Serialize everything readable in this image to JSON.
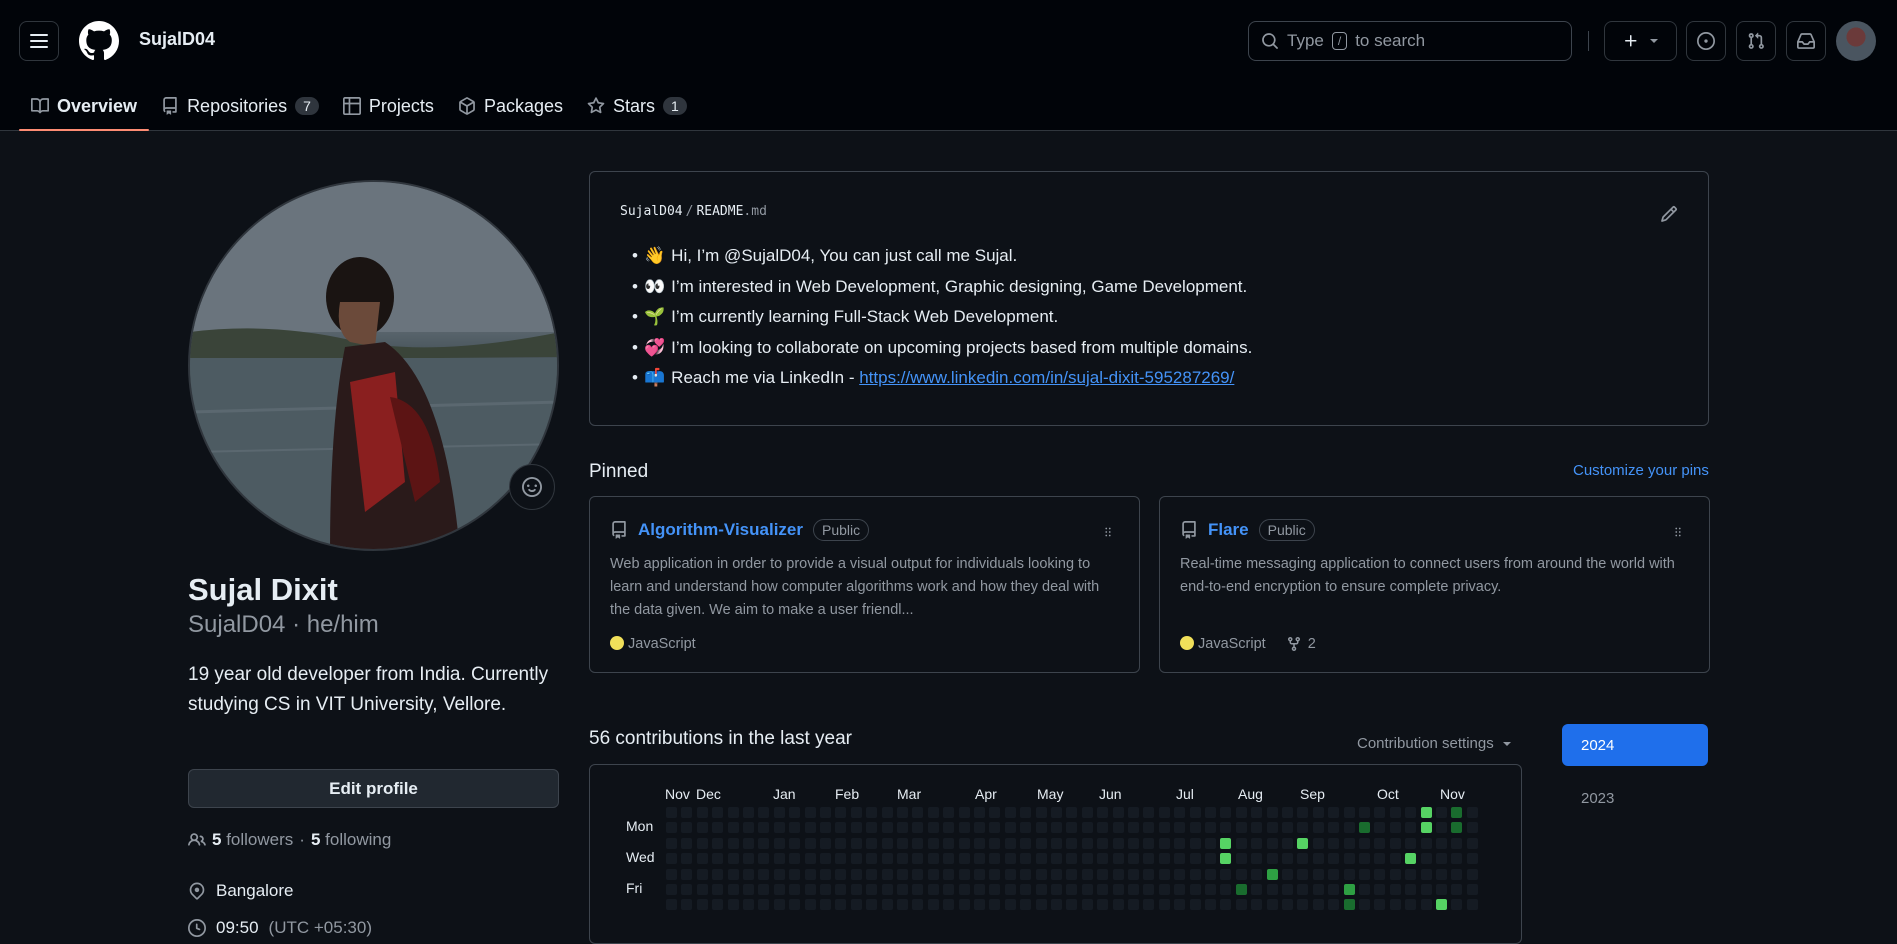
{
  "header": {
    "username": "SujalD04",
    "search": {
      "prefix": "Type",
      "key": "/",
      "suffix": "to search"
    }
  },
  "tabs": [
    {
      "label": "Overview",
      "count": null,
      "active": true,
      "icon": "book-icon"
    },
    {
      "label": "Repositories",
      "count": "7",
      "icon": "repo-icon"
    },
    {
      "label": "Projects",
      "count": null,
      "icon": "table-icon"
    },
    {
      "label": "Packages",
      "count": null,
      "icon": "package-icon"
    },
    {
      "label": "Stars",
      "count": "1",
      "icon": "star-icon"
    }
  ],
  "profile": {
    "full_name": "Sujal Dixit",
    "handle": "SujalD04 · he/him",
    "bio": "19 year old developer from India. Currently studying CS in VIT University, Vellore.",
    "edit_label": "Edit profile",
    "followers_count": "5",
    "followers_label": "followers",
    "sep": "·",
    "following_count": "5",
    "following_label": "following",
    "location": "Bangalore",
    "time": "09:50",
    "timezone": "(UTC +05:30)"
  },
  "readme": {
    "owner": "SujalD04",
    "file": "README",
    "ext": ".md",
    "items": [
      {
        "emoji": "👋",
        "text": "Hi, I’m @SujalD04, You can just call me Sujal."
      },
      {
        "emoji": "👀",
        "text": "I’m interested in Web Development, Graphic designing, Game Development."
      },
      {
        "emoji": "🌱",
        "text": "I’m currently learning Full-Stack Web Development."
      },
      {
        "emoji": "💞️",
        "text": "I’m looking to collaborate on upcoming projects based from multiple domains."
      },
      {
        "emoji": "📫",
        "text": "Reach me via LinkedIn - ",
        "link": "https://www.linkedin.com/in/sujal-dixit-595287269/"
      }
    ]
  },
  "pinned": {
    "title": "Pinned",
    "customize": "Customize your pins",
    "cards": [
      {
        "name": "Algorithm-Visualizer",
        "visibility": "Public",
        "description": "Web application in order to provide a visual output for individuals looking to learn and understand how computer algorithms work and how they deal with the data given. We aim to make a user friendl...",
        "language": "JavaScript",
        "language_color": "#f1e05a",
        "forks": null
      },
      {
        "name": "Flare",
        "visibility": "Public",
        "description": "Real-time messaging application to connect users from around the world with end-to-end encryption to ensure complete privacy.",
        "language": "JavaScript",
        "language_color": "#f1e05a",
        "forks": "2"
      }
    ]
  },
  "contributions": {
    "title": "56 contributions in the last year",
    "settings": "Contribution settings",
    "months": [
      "Nov",
      "Dec",
      "Jan",
      "Feb",
      "Mar",
      "Apr",
      "May",
      "Jun",
      "Jul",
      "Aug",
      "Sep",
      "Oct",
      "Nov"
    ],
    "days": [
      "Mon",
      "Wed",
      "Fri"
    ],
    "years": [
      "2024",
      "2023"
    ],
    "colors": {
      "empty": "#151b23",
      "l1": "#033a16",
      "l2": "#196c2e",
      "l3": "#2ea043",
      "l4": "#56d364"
    },
    "active_cells": [
      {
        "week": 51,
        "day": 0,
        "level": "l2"
      },
      {
        "week": 49,
        "day": 0,
        "level": "l4"
      },
      {
        "week": 49,
        "day": 1,
        "level": "l4"
      },
      {
        "week": 51,
        "day": 1,
        "level": "l2"
      },
      {
        "week": 45,
        "day": 1,
        "level": "l2"
      },
      {
        "week": 36,
        "day": 2,
        "level": "l4"
      },
      {
        "week": 41,
        "day": 2,
        "level": "l4"
      },
      {
        "week": 36,
        "day": 3,
        "level": "l4"
      },
      {
        "week": 48,
        "day": 3,
        "level": "l4"
      },
      {
        "week": 39,
        "day": 4,
        "level": "l3"
      },
      {
        "week": 37,
        "day": 5,
        "level": "l2"
      },
      {
        "week": 44,
        "day": 5,
        "level": "l3"
      },
      {
        "week": 44,
        "day": 6,
        "level": "l2"
      },
      {
        "week": 50,
        "day": 6,
        "level": "l4"
      }
    ]
  }
}
